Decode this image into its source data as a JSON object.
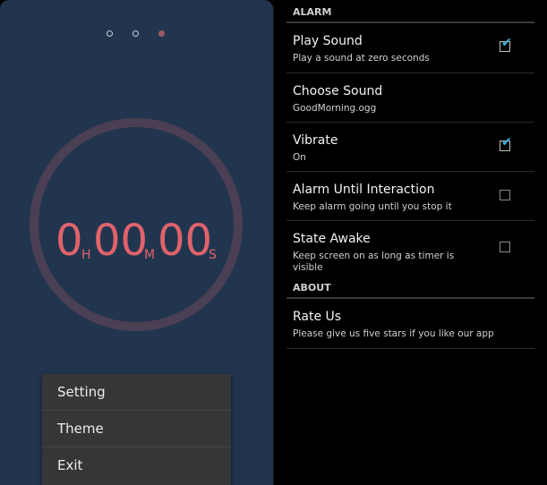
{
  "timer": {
    "hours": "0",
    "hours_unit": "H",
    "minutes": "00",
    "minutes_unit": "M",
    "seconds": "00",
    "seconds_unit": "S"
  },
  "page_indicator": {
    "count": 3,
    "active": 3
  },
  "menu": {
    "items": [
      "Setting",
      "Theme",
      "Exit"
    ]
  },
  "settings": {
    "alarm_header": "ALARM",
    "items": [
      {
        "title": "Play Sound",
        "subtitle": "Play a sound at zero seconds",
        "checked": true
      },
      {
        "title": "Choose Sound",
        "subtitle": "GoodMorning.ogg"
      },
      {
        "title": "Vibrate",
        "subtitle": "On",
        "checked": true
      },
      {
        "title": "Alarm Until Interaction",
        "subtitle": "Keep alarm going until you stop it",
        "checked": false
      },
      {
        "title": "State Awake",
        "subtitle": "Keep screen on as long as timer is visible",
        "checked": false
      }
    ],
    "about_header": "ABOUT",
    "about_items": [
      {
        "title": "Rate Us",
        "subtitle": "Please give us five stars if you like our app"
      }
    ]
  },
  "colors": {
    "left_background": "#22354f",
    "timer_text": "#e0636b",
    "ring": "#4b3f53",
    "checkbox_accent": "#33b5e5"
  },
  "icons": {
    "checkmark": "check-icon"
  }
}
